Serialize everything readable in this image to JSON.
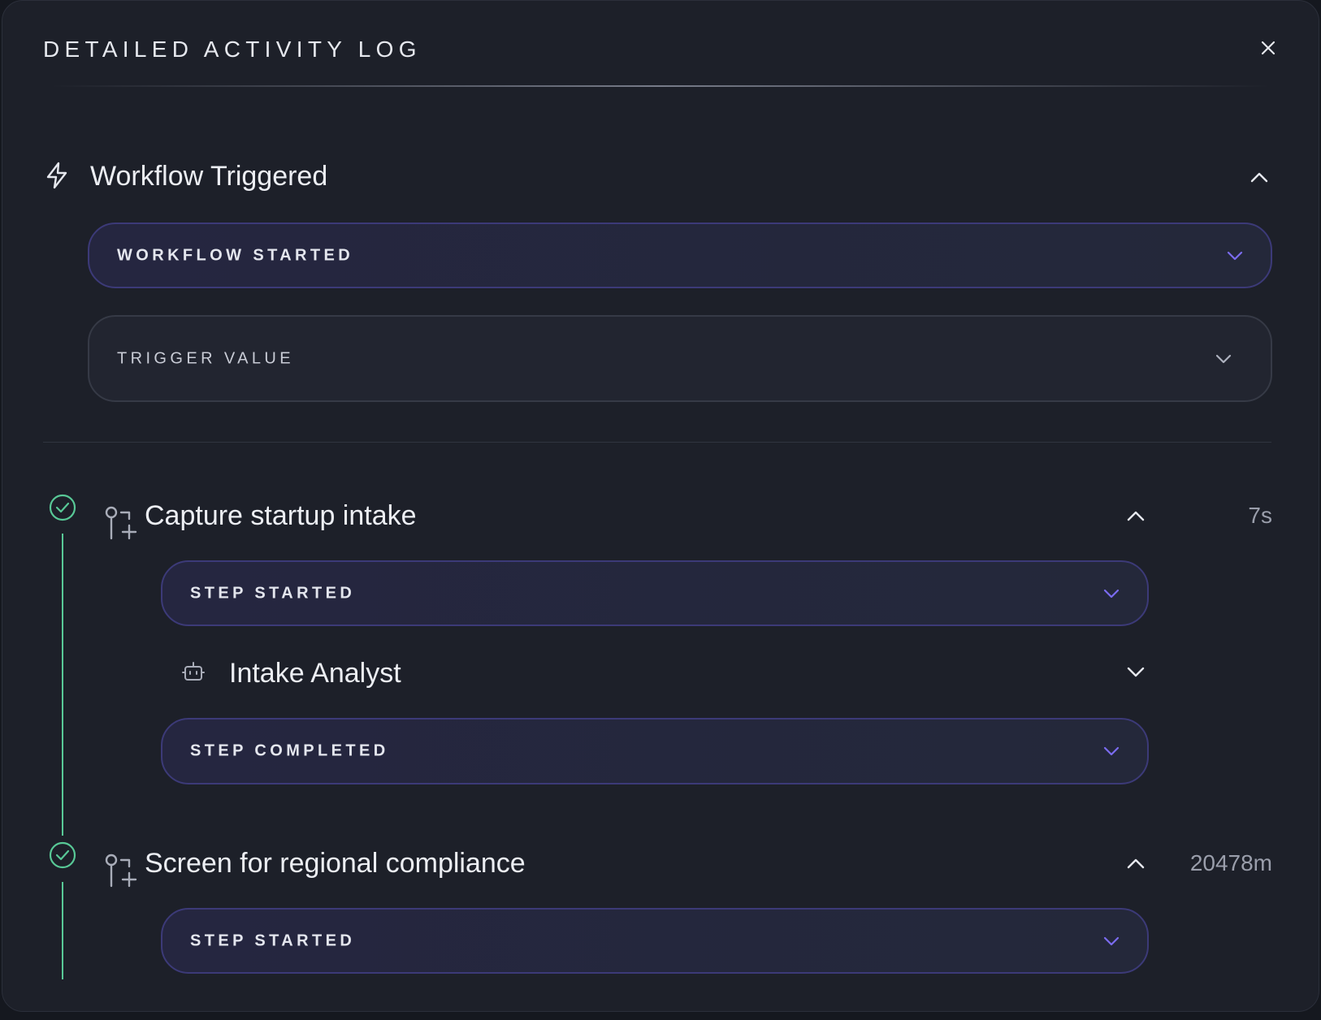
{
  "dialog": {
    "title": "DETAILED ACTIVITY LOG"
  },
  "trigger_section": {
    "title": "Workflow Triggered",
    "icon": "lightning-icon",
    "events": [
      {
        "label": "WORKFLOW STARTED"
      },
      {
        "label": "TRIGGER VALUE"
      }
    ]
  },
  "steps": [
    {
      "title": "Capture startup intake",
      "status": "completed",
      "duration": "7s",
      "events": [
        {
          "label": "STEP STARTED"
        },
        {
          "label": "STEP COMPLETED"
        }
      ],
      "agent": {
        "name": "Intake Analyst",
        "icon": "robot-icon"
      }
    },
    {
      "title": "Screen for regional compliance",
      "status": "completed",
      "duration": "20478m",
      "events": [
        {
          "label": "STEP STARTED"
        }
      ]
    }
  ],
  "colors": {
    "accent": "#7b6cf0",
    "success": "#58c896",
    "panel": "#1d2029"
  }
}
